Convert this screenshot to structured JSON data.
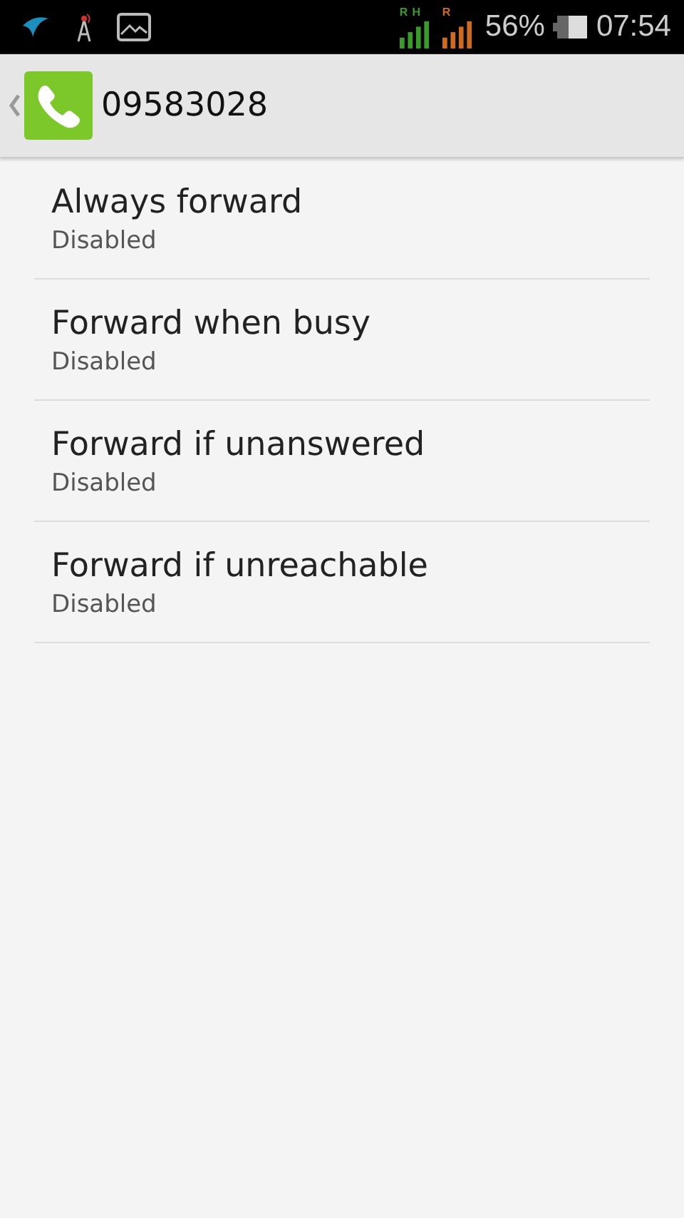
{
  "status_bar": {
    "signals": [
      {
        "roaming": "R",
        "network": "H",
        "color": "#3a9a2a"
      },
      {
        "roaming": "R",
        "color": "#d06a1e"
      }
    ],
    "battery": "56%",
    "time": "07:54"
  },
  "action_bar": {
    "title": "09583028"
  },
  "settings": [
    {
      "title": "Always forward",
      "summary": "Disabled"
    },
    {
      "title": "Forward when busy",
      "summary": "Disabled"
    },
    {
      "title": "Forward if unanswered",
      "summary": "Disabled"
    },
    {
      "title": "Forward if unreachable",
      "summary": "Disabled"
    }
  ]
}
